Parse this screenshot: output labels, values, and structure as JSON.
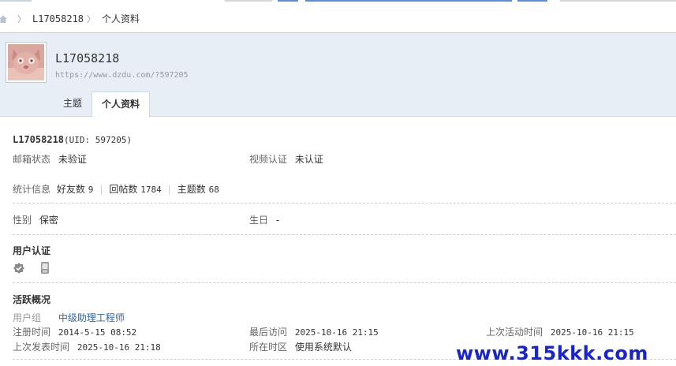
{
  "breadcrumb": {
    "items": [
      "L17058218",
      "个人资料"
    ],
    "separator": "〉"
  },
  "profile": {
    "username": "L17058218",
    "url": "https://www.dzdu.com/?597205"
  },
  "tabs": [
    {
      "label": "主题",
      "active": false
    },
    {
      "label": "个人资料",
      "active": true
    }
  ],
  "info": {
    "name_line": "L17058218",
    "uid_text": "(UID: 597205)",
    "email_label": "邮箱状态",
    "email_value": "未验证",
    "video_label": "视频认证",
    "video_value": "未认证",
    "stats_label": "统计信息",
    "friends_label": "好友数",
    "friends_value": "9",
    "replies_label": "回帖数",
    "replies_value": "1784",
    "topics_label": "主题数",
    "topics_value": "68",
    "gender_label": "性别",
    "gender_value": "保密",
    "birthday_label": "生日",
    "birthday_value": "-"
  },
  "verification": {
    "heading": "用户认证",
    "icons": [
      "verified-badge-icon",
      "mobile-phone-icon"
    ]
  },
  "activity": {
    "heading": "活跃概况",
    "group_label": "用户组",
    "group_value": "中级助理工程师",
    "reg_label": "注册时间",
    "reg_value": "2014-5-15 08:52",
    "last_visit_label": "最后访问",
    "last_visit_value": "2025-10-16 21:15",
    "last_active_label": "上次活动时间",
    "last_active_value": "2025-10-16 21:15",
    "last_post_label": "上次发表时间",
    "last_post_value": "2025-10-16 21:18",
    "timezone_label": "所在时区",
    "timezone_value": "使用系统默认"
  },
  "watermark": "www.315kkk.com",
  "colors": {
    "header_bg": "#e8eef6",
    "link": "#336699",
    "watermark": "#1a25c9"
  }
}
